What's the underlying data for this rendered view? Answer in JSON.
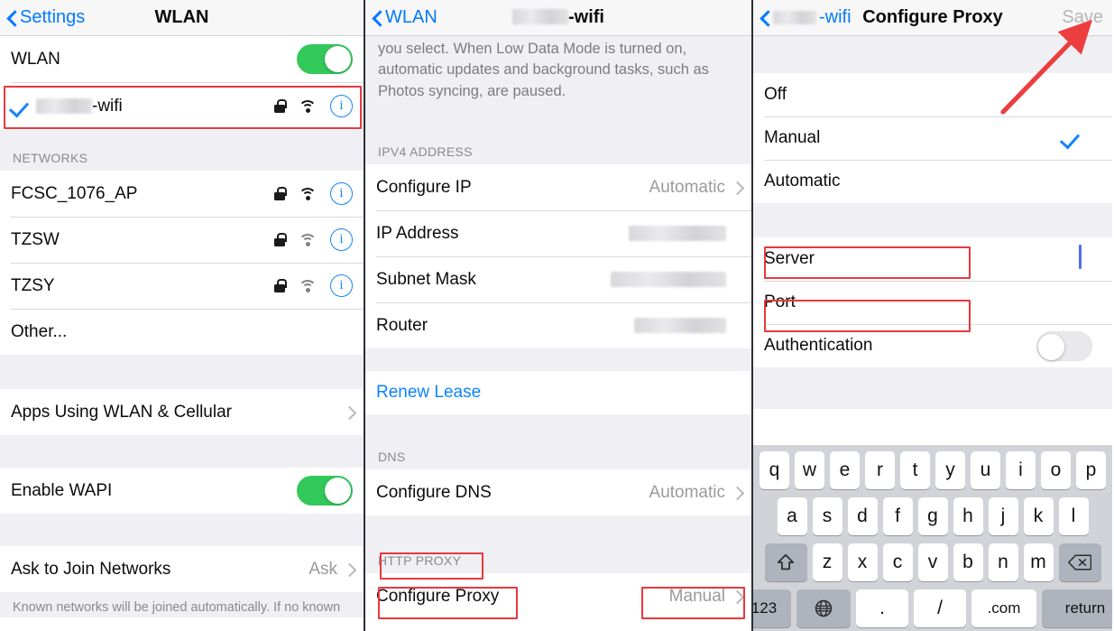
{
  "annotations": {
    "arrow_color": "#e8393c",
    "box_color": "#e8393c",
    "arrow_target": "Save"
  },
  "left_panel": {
    "navbar": {
      "back_label": "Settings",
      "title": "WLAN",
      "back_icon": "chevron-left-icon"
    },
    "wlan_toggle": {
      "label": "WLAN",
      "state": "on"
    },
    "connected_network": {
      "name_redacted": true,
      "name_suffix": "-wifi",
      "checked": true,
      "icons": [
        "lock-icon",
        "wifi-icon",
        "info-icon"
      ]
    },
    "networks_header": "NETWORKS",
    "networks": [
      {
        "name": "FCSC_1076_AP",
        "secure": true,
        "signal": "strong"
      },
      {
        "name": "TZSW",
        "secure": true,
        "signal": "weak"
      },
      {
        "name": "TZSY",
        "secure": true,
        "signal": "weak"
      }
    ],
    "other_label": "Other...",
    "apps_using": {
      "label": "Apps Using WLAN & Cellular",
      "accessory": "chevron-right-icon"
    },
    "enable_wapi": {
      "label": "Enable WAPI",
      "state": "on"
    },
    "ask_to_join": {
      "label": "Ask to Join Networks",
      "value": "Ask",
      "accessory": "chevron-right-icon"
    },
    "footnote": "Known networks will be joined automatically. If no known"
  },
  "mid_panel": {
    "navbar": {
      "back_label": "WLAN",
      "title_redacted": true,
      "title_suffix": "-wifi",
      "back_icon": "chevron-left-icon"
    },
    "intro_text": "over your cellular network or specific WLAN networks you select. When Low Data Mode is turned on, automatic updates and background tasks, such as Photos syncing, are paused.",
    "ipv4_header": "IPV4 ADDRESS",
    "ipv4_rows": [
      {
        "label": "Configure IP",
        "value": "Automatic",
        "accessory": "chevron-right-icon",
        "redacted": false
      },
      {
        "label": "IP Address",
        "value": "",
        "accessory": "",
        "redacted": true
      },
      {
        "label": "Subnet Mask",
        "value": "",
        "accessory": "",
        "redacted": true
      },
      {
        "label": "Router",
        "value": "",
        "accessory": "",
        "redacted": true
      }
    ],
    "renew_lease": "Renew Lease",
    "dns_header": "DNS",
    "configure_dns": {
      "label": "Configure DNS",
      "value": "Automatic",
      "accessory": "chevron-right-icon"
    },
    "http_proxy_header": "HTTP PROXY",
    "configure_proxy": {
      "label": "Configure Proxy",
      "value": "Manual",
      "accessory": "chevron-right-icon"
    }
  },
  "right_panel": {
    "navbar": {
      "back_redacted": true,
      "back_suffix": "-wifi",
      "title": "Configure Proxy",
      "save_label": "Save",
      "save_enabled": false,
      "back_icon": "chevron-left-icon"
    },
    "proxy_modes": [
      {
        "label": "Off",
        "selected": false
      },
      {
        "label": "Manual",
        "selected": true
      },
      {
        "label": "Automatic",
        "selected": false
      }
    ],
    "server_field": {
      "label": "Server",
      "value": "",
      "focused": true
    },
    "port_field": {
      "label": "Port",
      "value": "",
      "focused": false
    },
    "authentication": {
      "label": "Authentication",
      "state": "off"
    },
    "keyboard": {
      "row1": [
        "q",
        "w",
        "e",
        "r",
        "t",
        "y",
        "u",
        "i",
        "o",
        "p"
      ],
      "row2": [
        "a",
        "s",
        "d",
        "f",
        "g",
        "h",
        "j",
        "k",
        "l"
      ],
      "row3": [
        "z",
        "x",
        "c",
        "v",
        "b",
        "n",
        "m"
      ],
      "shift_key": "shift-icon",
      "delete_key": "backspace-icon",
      "numbers_key": "123",
      "globe_key": "globe-icon",
      "period_key": ".",
      "slash_key": "/",
      "dotcom_key": ".com",
      "return_key": "return"
    }
  }
}
